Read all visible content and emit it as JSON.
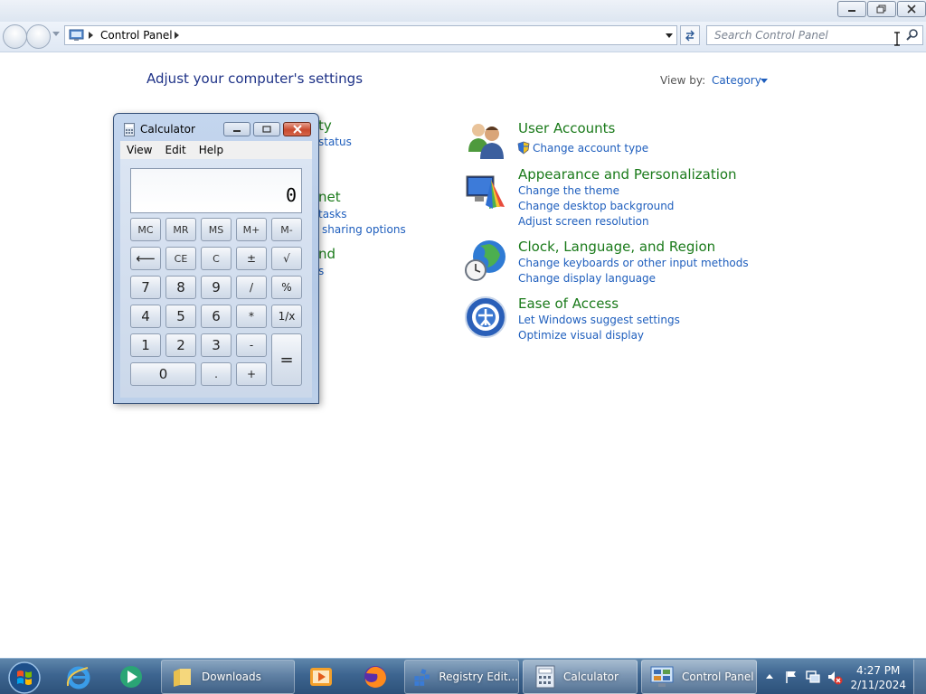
{
  "window": {
    "breadcrumb": [
      "Control Panel"
    ],
    "search_placeholder": "Search Control Panel"
  },
  "main": {
    "heading": "Adjust your computer's settings",
    "view_by_label": "View by:",
    "view_by_value": "Category",
    "obscured_fragments": {
      "system_security_title": "ty",
      "system_security_link": "status",
      "network_title": "net",
      "network_link1": "tasks",
      "network_link2": "sharing options",
      "hardware_title": "nd",
      "hardware_link": "s"
    },
    "categories": [
      {
        "title": "User Accounts",
        "links": [
          "Change account type"
        ],
        "icon": "user-accounts-icon"
      },
      {
        "title": "Appearance and Personalization",
        "links": [
          "Change the theme",
          "Change desktop background",
          "Adjust screen resolution"
        ],
        "icon": "appearance-icon"
      },
      {
        "title": "Clock, Language, and Region",
        "links": [
          "Change keyboards or other input methods",
          "Change display language"
        ],
        "icon": "clock-globe-icon"
      },
      {
        "title": "Ease of Access",
        "links": [
          "Let Windows suggest settings",
          "Optimize visual display"
        ],
        "icon": "ease-of-access-icon"
      }
    ]
  },
  "calculator": {
    "title": "Calculator",
    "menu": [
      "View",
      "Edit",
      "Help"
    ],
    "display": "0",
    "keys": {
      "mc": "MC",
      "mr": "MR",
      "ms": "MS",
      "mplus": "M+",
      "mminus": "M-",
      "back": "⟵",
      "ce": "CE",
      "c": "C",
      "plusminus": "±",
      "sqrt": "√",
      "k7": "7",
      "k8": "8",
      "k9": "9",
      "div": "/",
      "pct": "%",
      "k4": "4",
      "k5": "5",
      "k6": "6",
      "mul": "*",
      "recip": "1/x",
      "k1": "1",
      "k2": "2",
      "k3": "3",
      "sub": "-",
      "eq": "=",
      "k0": "0",
      "dot": ".",
      "add": "+"
    }
  },
  "taskbar": {
    "tasks": [
      "Downloads",
      "Registry Edit...",
      "Calculator",
      "Control Panel"
    ],
    "time": "4:27 PM",
    "date": "2/11/2024"
  },
  "colors": {
    "link": "#1e5ebd",
    "category_title": "#1a7a1a",
    "taskbar": "#3d6590"
  }
}
